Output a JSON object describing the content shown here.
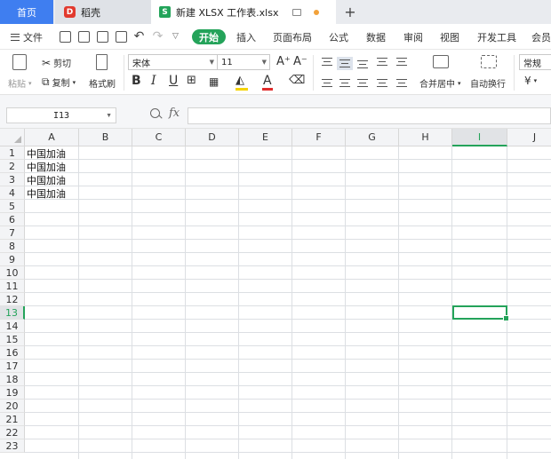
{
  "tabs": {
    "home": "首页",
    "docer": "稻壳",
    "file": "新建 XLSX 工作表.xlsx",
    "add": "+"
  },
  "menu": {
    "file": "文件",
    "start": "开始",
    "items": [
      "插入",
      "页面布局",
      "公式",
      "数据",
      "审阅",
      "视图",
      "开发工具",
      "会员"
    ]
  },
  "ribbon": {
    "paste": "粘贴",
    "cut": "剪切",
    "copy": "复制",
    "format_painter": "格式刷",
    "font_name": "宋体",
    "font_size": "11",
    "font_grow": "A⁺",
    "font_shrink": "A⁻",
    "bold": "B",
    "italic": "I",
    "underline": "U",
    "font_color_glyph": "A",
    "font_color": "#e02d2d",
    "fill_color": "#f5d300",
    "merge_center": "合并居中",
    "wrap_text": "自动换行",
    "number_format": "常规",
    "currency": "¥"
  },
  "formula_bar": {
    "name_box": "I13",
    "fx_label": "fx",
    "formula": ""
  },
  "sheet": {
    "columns": [
      "A",
      "B",
      "C",
      "D",
      "E",
      "F",
      "G",
      "H",
      "I",
      "J"
    ],
    "selected_column": "I",
    "rows": [
      "1",
      "2",
      "3",
      "4",
      "5",
      "6",
      "7",
      "8",
      "9",
      "10",
      "11",
      "12",
      "13",
      "14",
      "15",
      "16",
      "17",
      "18",
      "19",
      "20",
      "21",
      "22",
      "23"
    ],
    "selected_row": "13",
    "cells": {
      "A1": "中国加油",
      "A2": "中国加油",
      "A3": "中国加油",
      "A4": "中国加油"
    }
  },
  "colors": {
    "accent": "#24a35a",
    "home_tab": "#3f7ef0"
  }
}
